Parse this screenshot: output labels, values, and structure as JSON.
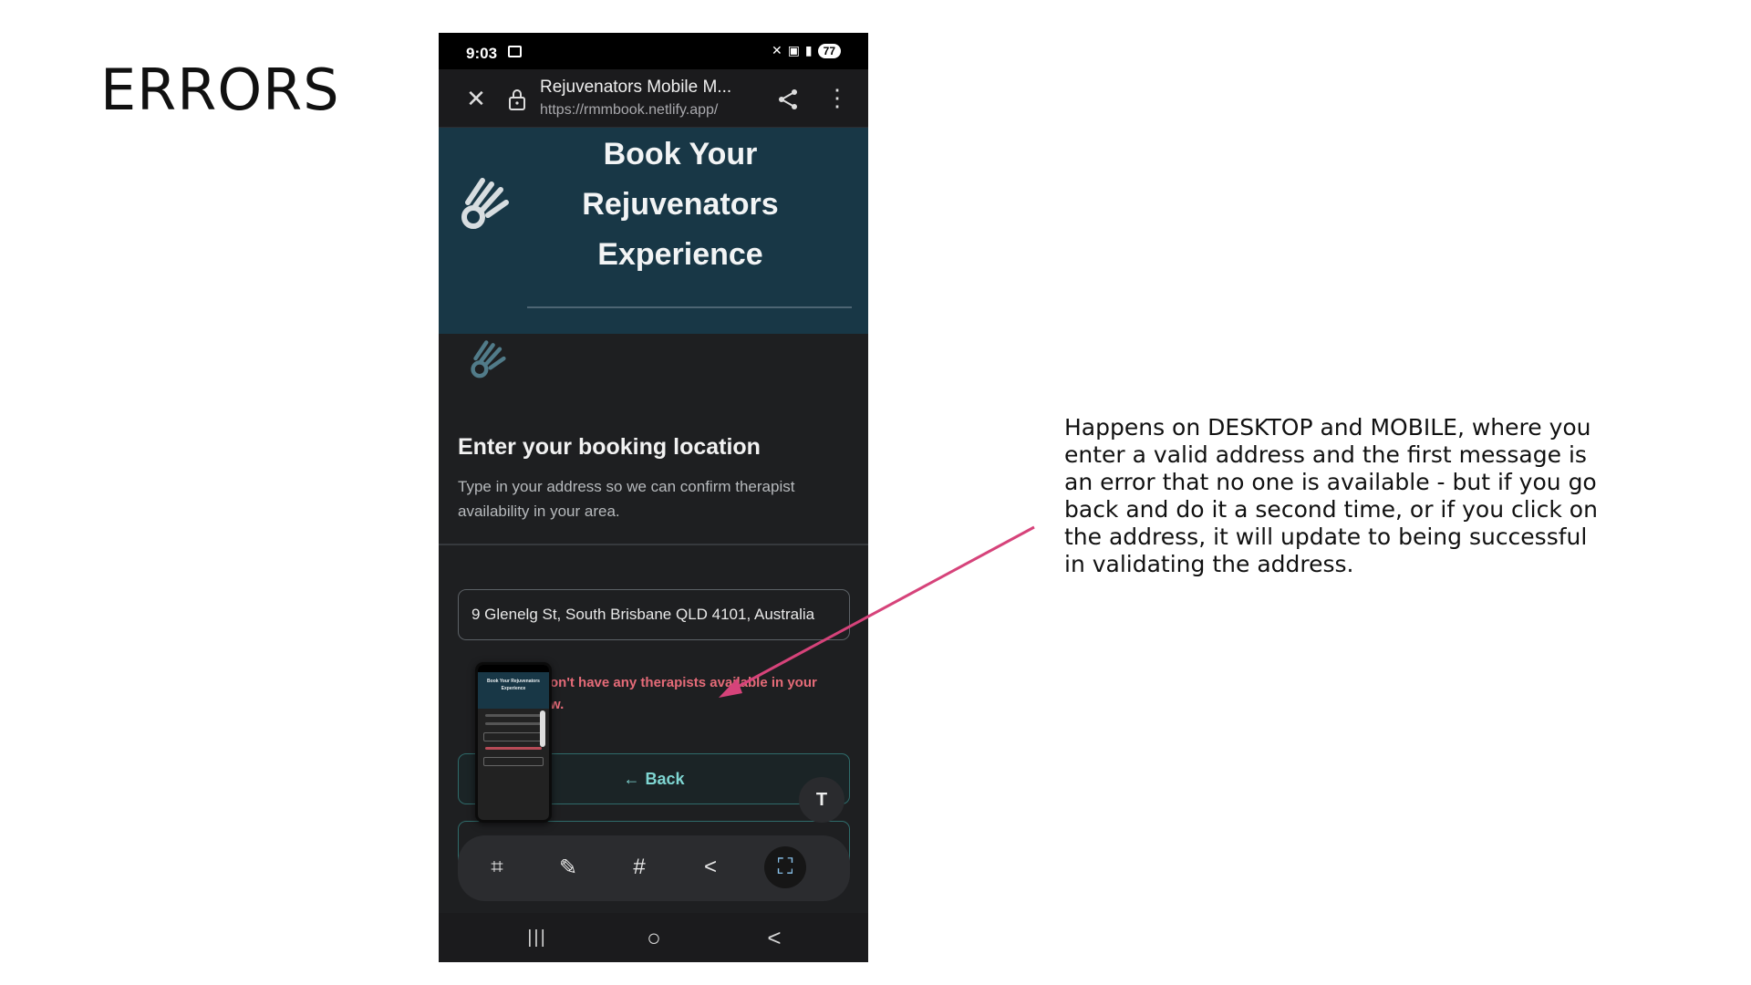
{
  "slide": {
    "title": "ERRORS",
    "note": "Happens on DESKTOP and MOBILE, where you enter a valid address and the first message is an error that no one is available - but if you go back and do it a second time, or if you click on the address, it will update to being successful in validating the address."
  },
  "status_bar": {
    "time": "9:03",
    "battery": "77"
  },
  "browser": {
    "tab_title": "Rejuvenators Mobile M...",
    "url": "https://rmmbook.netlify.app/"
  },
  "hero": {
    "title_lines": [
      "Book Your",
      "Rejuvenators",
      "Experience"
    ]
  },
  "location": {
    "heading": "Enter your booking location",
    "description": "Type in your address so we can confirm therapist availability in your area.",
    "address_value": "9 Glenelg St, South Brisbane QLD 4101, Australia",
    "error_line_1": "on't have any therapists available in your",
    "error_line_2": "w.",
    "back_label": "Back",
    "back_arrow": "←"
  },
  "thumbnail": {
    "hero_text": "Book Your Rejuvenators Experience"
  },
  "toolbar": {
    "items": [
      {
        "icon": "smart-select-icon",
        "glyph": "⌗"
      },
      {
        "icon": "draw-icon",
        "glyph": "✎"
      },
      {
        "icon": "hashtag-icon",
        "glyph": "#"
      },
      {
        "icon": "share-icon",
        "glyph": "<"
      },
      {
        "icon": "expand-capture-icon",
        "glyph": "⛶"
      }
    ],
    "text_extract_glyph": "T"
  },
  "nav_bar": {
    "recents_glyph": "|||",
    "home_glyph": "○",
    "back_glyph": "<"
  },
  "colors": {
    "hero_bg": "#183746",
    "page_bg": "#1e1f21",
    "error_text": "#e56b78",
    "accent_teal": "#7fd6d2",
    "annotation_arrow": "#d6437a"
  }
}
